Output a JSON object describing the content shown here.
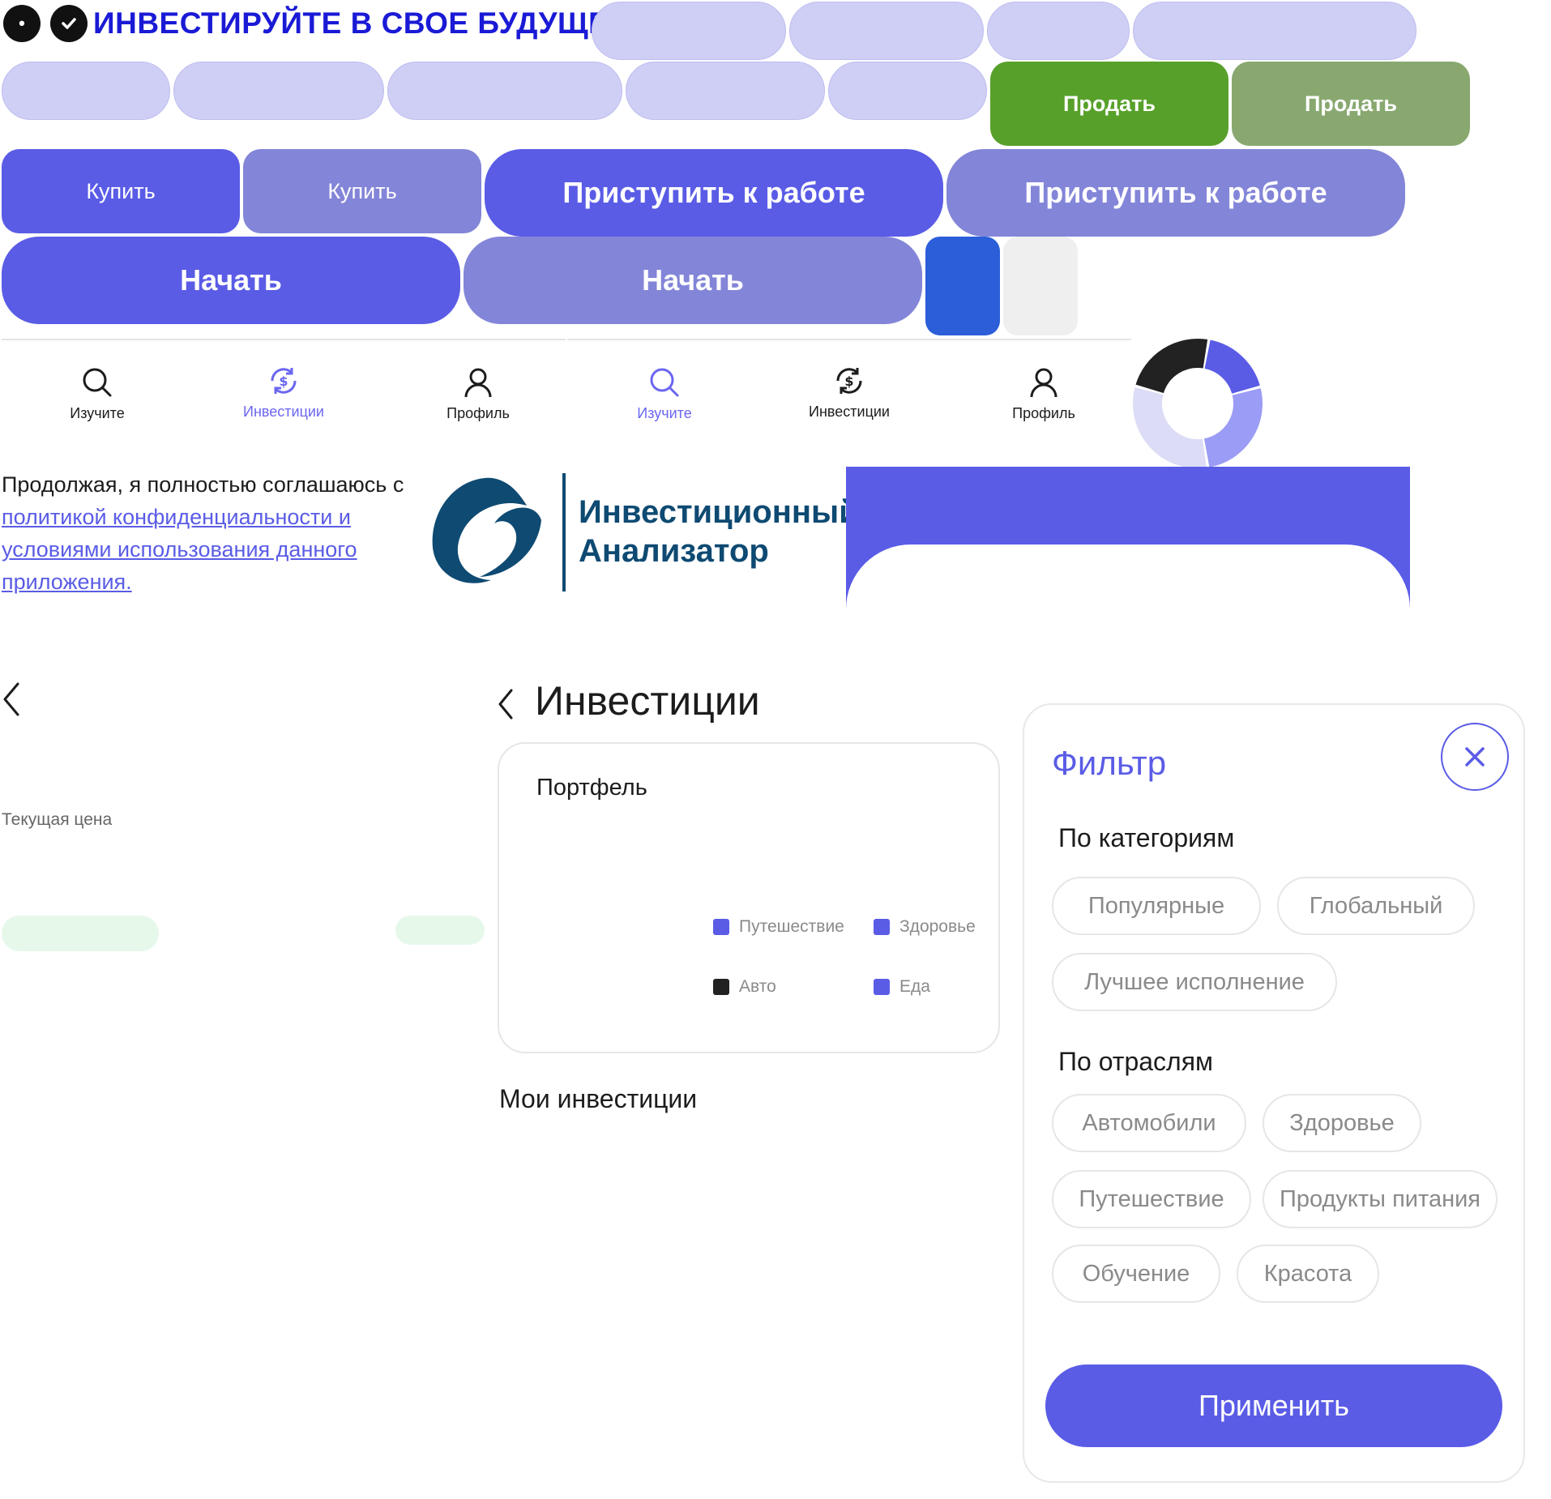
{
  "header": {
    "title": "ИНВЕСТИРУЙТЕ В СВОЕ БУДУЩЕЕ",
    "icon1": "dot-icon",
    "icon2": "check-icon"
  },
  "buttons": {
    "sell_primary": "Продать",
    "sell_muted": "Продать",
    "buy_primary": "Купить",
    "buy_muted": "Купить",
    "start_work_primary": "Приступить к работе",
    "start_work_muted": "Приступить к работе",
    "begin_primary": "Начать",
    "begin_muted": "Начать"
  },
  "colors": {
    "primary": "#5a5ce6",
    "muted": "#8385d8",
    "sell": "#57a02a",
    "sell_muted": "#88a870",
    "swatch_blue": "#2b5ed8",
    "swatch_grey": "#efefef",
    "logo": "#0e4a72"
  },
  "navbar_left": [
    {
      "label": "Изучите",
      "icon": "search-icon",
      "active": false
    },
    {
      "label": "Инвестиции",
      "icon": "dollar-exchange-icon",
      "active": true
    },
    {
      "label": "Профиль",
      "icon": "user-icon",
      "active": false
    }
  ],
  "navbar_right": [
    {
      "label": "Изучите",
      "icon": "search-icon",
      "active": true
    },
    {
      "label": "Инвестиции",
      "icon": "dollar-exchange-icon",
      "active": false
    },
    {
      "label": "Профиль",
      "icon": "user-icon",
      "active": false
    }
  ],
  "consent": {
    "prefix": "Продолжая, я полностью соглашаюсь с ",
    "link": "политикой конфиденциальности и условиями использования данного приложения."
  },
  "logo": {
    "line1": "Инвестиционный",
    "line2": "Анализатор"
  },
  "price_screen": {
    "current_price_label": "Текущая цена"
  },
  "investments": {
    "title": "Инвестиции",
    "portfolio_label": "Портфель",
    "my_investments": "Мои инвестиции",
    "legend": [
      {
        "label": "Путешествие",
        "color": "#5a5ce6"
      },
      {
        "label": "Здоровье",
        "color": "#5a5ce6"
      },
      {
        "label": "Авто",
        "color": "#222222"
      },
      {
        "label": "Еда",
        "color": "#5a5ce6"
      }
    ]
  },
  "filter": {
    "title": "Фильтр",
    "section1": "По категориям",
    "categories": [
      "Популярные",
      "Глобальный",
      "Лучшее исполнение"
    ],
    "section2": "По отраслям",
    "industries": [
      "Автомобили",
      "Здоровье",
      "Путешествие",
      "Продукты питания",
      "Обучение",
      "Красота"
    ],
    "apply": "Применить"
  },
  "donut": {
    "segments": [
      {
        "value": 17,
        "color": "#5a5ce6"
      },
      {
        "value": 25,
        "color": "#9b9cf5"
      },
      {
        "value": 30,
        "color": "#dcdcf6"
      },
      {
        "value": 22,
        "color": "#222222"
      }
    ]
  }
}
